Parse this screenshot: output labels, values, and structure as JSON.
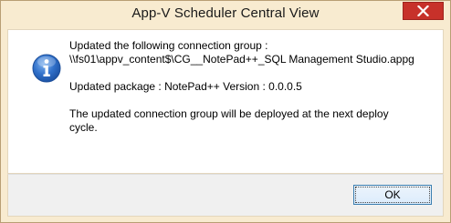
{
  "window": {
    "title": "App-V Scheduler Central View"
  },
  "icons": {
    "close": "close-icon",
    "info": "information-icon"
  },
  "message": {
    "line1": "Updated the following connection group :",
    "line2": "\\\\fs01\\appv_content$\\CG__NotePad++_SQL Management Studio.appg",
    "line3": "Updated package : NotePad++ Version : 0.0.0.5",
    "line4": "The updated connection group will be deployed at the next deploy",
    "line5": "cycle."
  },
  "buttons": {
    "ok_label": "OK"
  },
  "colors": {
    "frame": "#f8ebd0",
    "close_button": "#c7312a",
    "ok_border": "#3c7fb1"
  }
}
